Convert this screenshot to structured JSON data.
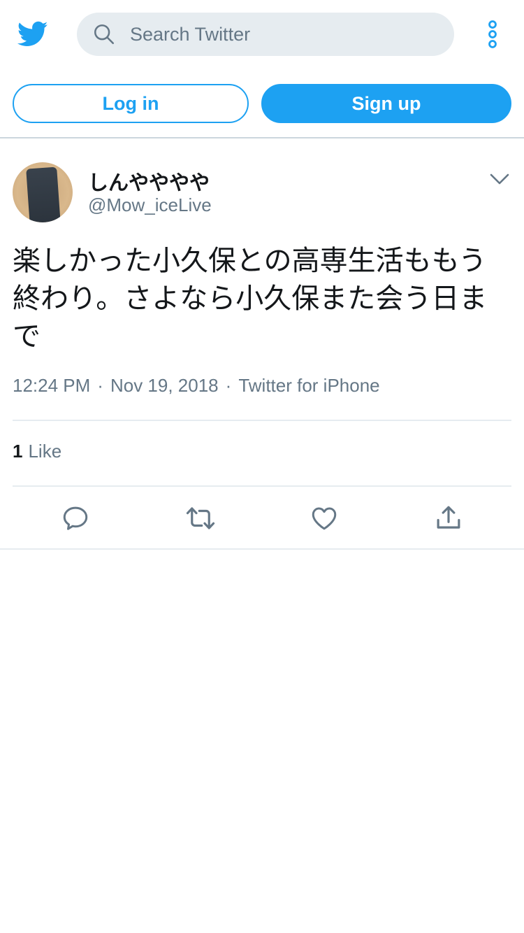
{
  "colors": {
    "brand": "#1da1f2",
    "muted": "#657786",
    "text": "#14171a",
    "search_bg": "#e6ecf0",
    "divider": "#e6ecf0"
  },
  "header": {
    "logo_icon": "twitter-bird-icon",
    "search": {
      "placeholder": "Search Twitter",
      "icon": "search-icon"
    },
    "more_icon": "more-vertical-icon"
  },
  "auth": {
    "login_label": "Log in",
    "signup_label": "Sign up"
  },
  "tweet": {
    "display_name": "しんやややや",
    "handle": "@Mow_iceLive",
    "text": "楽しかった小久保との高専生活ももう終わり。さよなら小久保また会う日まで",
    "time": "12:24 PM",
    "date": "Nov 19, 2018",
    "source": "Twitter for iPhone",
    "separator": "·",
    "like_count": "1",
    "like_label": "Like",
    "actions": [
      "reply-icon",
      "retweet-icon",
      "like-icon",
      "share-icon"
    ]
  }
}
